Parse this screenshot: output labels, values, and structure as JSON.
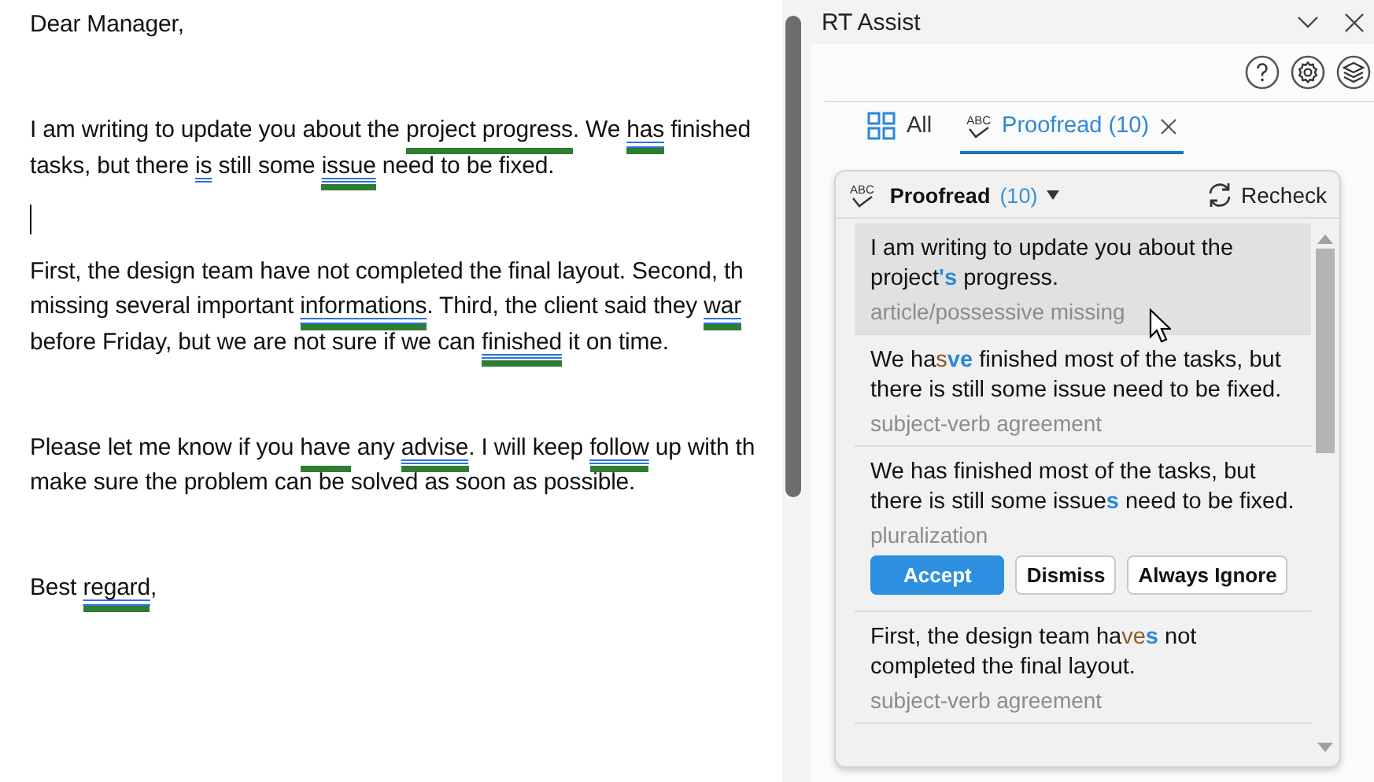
{
  "document": {
    "paragraphs": [
      {
        "kind": "text",
        "lines": [
          [
            {
              "kind": "plain",
              "text": "Dear Manager,"
            }
          ]
        ]
      },
      {
        "kind": "blank"
      },
      {
        "kind": "text",
        "lines": [
          [
            {
              "kind": "plain",
              "text": "I am writing to update you about the "
            },
            {
              "kind": "flagged",
              "text": "project progress",
              "double_underline": false,
              "bar": true
            },
            {
              "kind": "plain",
              "text": ". We "
            },
            {
              "kind": "flagged",
              "text": "has",
              "double_underline": true,
              "bar": true
            },
            {
              "kind": "plain",
              "text": " finished"
            }
          ],
          [
            {
              "kind": "plain",
              "text": "tasks, but there "
            },
            {
              "kind": "flagged",
              "text": "is",
              "double_underline": true,
              "bar": false
            },
            {
              "kind": "plain",
              "text": " still some "
            },
            {
              "kind": "flagged",
              "text": "issue",
              "double_underline": true,
              "bar": true
            },
            {
              "kind": "plain",
              "text": " need to be fixed."
            }
          ]
        ]
      },
      {
        "kind": "caret"
      },
      {
        "kind": "text",
        "lines": [
          [
            {
              "kind": "plain",
              "text": "First, the design team have not completed the final layout. Second, th"
            }
          ],
          [
            {
              "kind": "plain",
              "text": "missing several important "
            },
            {
              "kind": "flagged",
              "text": "informations",
              "double_underline": true,
              "bar": true
            },
            {
              "kind": "plain",
              "text": ". Third, the client said they "
            },
            {
              "kind": "flagged",
              "text": "war",
              "double_underline": true,
              "bar": true
            }
          ],
          [
            {
              "kind": "plain",
              "text": "before Friday, but we are not sure if we can "
            },
            {
              "kind": "flagged",
              "text": "finished",
              "double_underline": true,
              "bar": true
            },
            {
              "kind": "plain",
              "text": " it on time."
            }
          ]
        ]
      },
      {
        "kind": "blank"
      },
      {
        "kind": "text",
        "lines": [
          [
            {
              "kind": "plain",
              "text": "Please let me know if you "
            },
            {
              "kind": "flagged",
              "text": "have",
              "double_underline": false,
              "bar": true
            },
            {
              "kind": "plain",
              "text": " any "
            },
            {
              "kind": "flagged",
              "text": "advise",
              "double_underline": true,
              "bar": true
            },
            {
              "kind": "plain",
              "text": ". I will keep "
            },
            {
              "kind": "flagged",
              "text": "follow",
              "double_underline": true,
              "bar": true
            },
            {
              "kind": "plain",
              "text": " up with th"
            }
          ],
          [
            {
              "kind": "plain",
              "text": "make sure the problem can be solved as soon as possible."
            }
          ]
        ]
      },
      {
        "kind": "blank"
      },
      {
        "kind": "text",
        "lines": [
          [
            {
              "kind": "plain",
              "text": "Best "
            },
            {
              "kind": "flagged",
              "text": "regard",
              "double_underline": true,
              "bar": true
            },
            {
              "kind": "plain",
              "text": ","
            }
          ]
        ]
      }
    ]
  },
  "panel": {
    "title": "RT Assist",
    "tabs": [
      {
        "label": "All",
        "selected": false,
        "closable": false
      },
      {
        "label": "Proofread (10)",
        "badge": "ABC",
        "selected": true,
        "closable": true
      }
    ],
    "card": {
      "badge": "ABC",
      "title": "Proofread",
      "count": "(10)",
      "recheck": "Recheck",
      "suggestions": [
        {
          "segments": [
            {
              "kind": "plain",
              "text": "I am writing to update you about the project"
            },
            {
              "kind": "insert",
              "text": "'s"
            },
            {
              "kind": "plain",
              "text": " progress."
            }
          ],
          "category": "article/possessive missing",
          "selected": true,
          "expanded": false
        },
        {
          "segments": [
            {
              "kind": "plain",
              "text": "We ha"
            },
            {
              "kind": "delete",
              "text": "s"
            },
            {
              "kind": "insert",
              "text": "ve"
            },
            {
              "kind": "plain",
              "text": " finished most of the tasks, but there is still some issue need to be fixed."
            }
          ],
          "category": "subject-verb agreement",
          "selected": false,
          "expanded": false
        },
        {
          "segments": [
            {
              "kind": "plain",
              "text": "We has finished most of the tasks, but there is still some issue"
            },
            {
              "kind": "insert",
              "text": "s"
            },
            {
              "kind": "plain",
              "text": " need to be fixed."
            }
          ],
          "category": "pluralization",
          "selected": false,
          "expanded": true
        },
        {
          "segments": [
            {
              "kind": "plain",
              "text": "First, the design team ha"
            },
            {
              "kind": "delete",
              "text": "ve"
            },
            {
              "kind": "insert",
              "text": "s"
            },
            {
              "kind": "plain",
              "text": " not completed the final layout."
            }
          ],
          "category": "subject-verb agreement",
          "selected": false,
          "expanded": false
        }
      ],
      "actions": [
        {
          "label": "Accept",
          "kind": "primary"
        },
        {
          "label": "Dismiss",
          "kind": "secondary"
        },
        {
          "label": "Always Ignore",
          "kind": "secondary"
        }
      ]
    }
  }
}
